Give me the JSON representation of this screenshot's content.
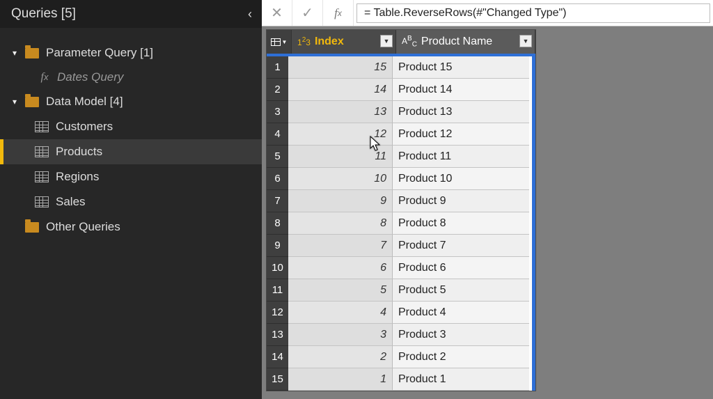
{
  "sidebar": {
    "title": "Queries [5]",
    "folders": [
      {
        "label": "Parameter Query [1]",
        "items": [
          {
            "kind": "fx",
            "label": "Dates Query"
          }
        ]
      },
      {
        "label": "Data Model [4]",
        "items": [
          {
            "kind": "table",
            "label": "Customers"
          },
          {
            "kind": "table",
            "label": "Products",
            "selected": true
          },
          {
            "kind": "table",
            "label": "Regions"
          },
          {
            "kind": "table",
            "label": "Sales"
          }
        ]
      },
      {
        "label": "Other Queries",
        "items": []
      }
    ]
  },
  "formula_bar": {
    "formula": "= Table.ReverseRows(#\"Changed Type\")"
  },
  "grid": {
    "columns": [
      {
        "name": "Index",
        "type": "number"
      },
      {
        "name": "Product Name",
        "type": "text"
      }
    ],
    "rows": [
      {
        "n": 1,
        "index": 15,
        "name": "Product 15"
      },
      {
        "n": 2,
        "index": 14,
        "name": "Product 14"
      },
      {
        "n": 3,
        "index": 13,
        "name": "Product 13"
      },
      {
        "n": 4,
        "index": 12,
        "name": "Product 12"
      },
      {
        "n": 5,
        "index": 11,
        "name": "Product 11"
      },
      {
        "n": 6,
        "index": 10,
        "name": "Product 10"
      },
      {
        "n": 7,
        "index": 9,
        "name": "Product 9"
      },
      {
        "n": 8,
        "index": 8,
        "name": "Product 8"
      },
      {
        "n": 9,
        "index": 7,
        "name": "Product 7"
      },
      {
        "n": 10,
        "index": 6,
        "name": "Product 6"
      },
      {
        "n": 11,
        "index": 5,
        "name": "Product 5"
      },
      {
        "n": 12,
        "index": 4,
        "name": "Product 4"
      },
      {
        "n": 13,
        "index": 3,
        "name": "Product 3"
      },
      {
        "n": 14,
        "index": 2,
        "name": "Product 2"
      },
      {
        "n": 15,
        "index": 1,
        "name": "Product 1"
      }
    ]
  }
}
